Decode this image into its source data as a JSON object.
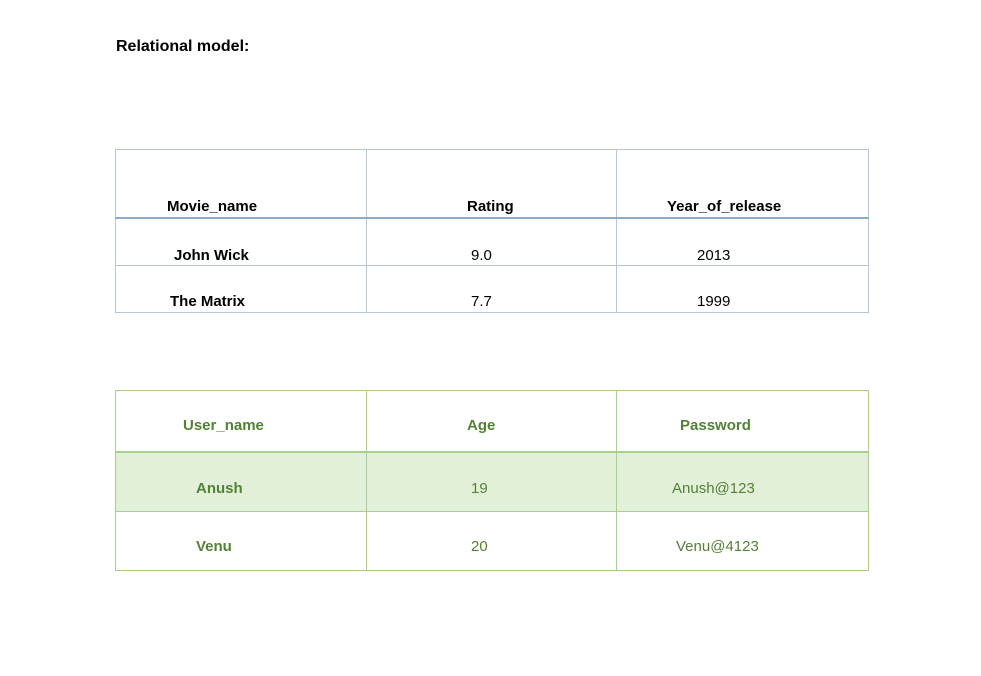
{
  "heading": "Relational model:",
  "movies_table": {
    "headers": [
      "Movie_name",
      "Rating",
      "Year_of_release"
    ],
    "rows": [
      [
        "John Wick",
        "9.0",
        "2013"
      ],
      [
        "The Matrix",
        "7.7",
        "1999"
      ]
    ],
    "border_color": "#b5c6d8",
    "text_color": "#000000"
  },
  "users_table": {
    "headers": [
      "User_name",
      "Age",
      "Password"
    ],
    "rows": [
      [
        "Anush",
        "19",
        "Anush@123"
      ],
      [
        "Venu",
        "20",
        "Venu@4123"
      ]
    ],
    "border_color": "#a8d08d",
    "text_color": "#538135",
    "band_color": "#e2efd9"
  }
}
